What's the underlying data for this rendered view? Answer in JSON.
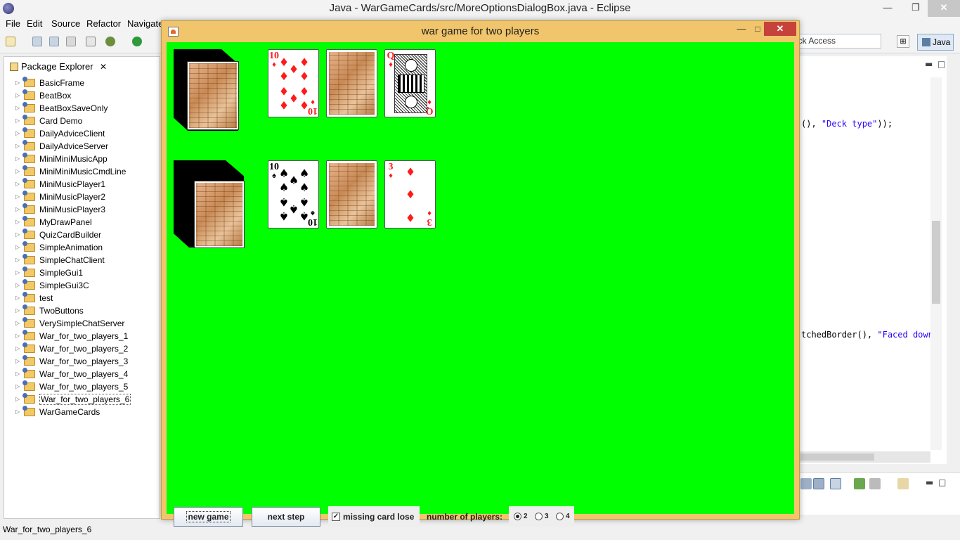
{
  "eclipse": {
    "title": "Java - WarGameCards/src/MoreOptionsDialogBox.java - Eclipse",
    "menu": [
      "File",
      "Edit",
      "Source",
      "Refactor",
      "Navigate"
    ],
    "quick_access": "ick Access",
    "perspective": "Java",
    "package_explorer": {
      "title": "Package Explorer",
      "items": [
        "BasicFrame",
        "BeatBox",
        "BeatBoxSaveOnly",
        "Card Demo",
        "DailyAdviceClient",
        "DailyAdviceServer",
        "MiniMiniMusicApp",
        "MiniMiniMusicCmdLine",
        "MiniMusicPlayer1",
        "MiniMusicPlayer2",
        "MiniMusicPlayer3",
        "MyDrawPanel",
        "QuizCardBuilder",
        "SimpleAnimation",
        "SimpleChatClient",
        "SimpleGui1",
        "SimpleGui3C",
        "test",
        "TwoButtons",
        "VerySimpleChatServer",
        "War_for_two_players_1",
        "War_for_two_players_2",
        "War_for_two_players_3",
        "War_for_two_players_4",
        "War_for_two_players_5",
        "War_for_two_players_6",
        "WarGameCards"
      ],
      "selected": "War_for_two_players_6"
    },
    "editor": {
      "line1_code": "(), ",
      "line1_string": "\"Deck type\"",
      "line1_end": "));",
      "line2_code": "tchedBorder(), ",
      "line2_string": "\"Faced down"
    },
    "status": "War_for_two_players_6"
  },
  "dialog": {
    "title": "war game for two players",
    "colors": {
      "table": "#00ff00",
      "frame": "#f0c56b",
      "close": "#c7423a"
    },
    "player1": {
      "cards": [
        {
          "rank": "10",
          "suit": "diamonds",
          "suit_symbol": "♦",
          "color": "red"
        },
        {
          "face_down": true
        },
        {
          "rank": "Q",
          "suit": "diamonds",
          "suit_symbol": "♦",
          "color": "red"
        }
      ]
    },
    "player2": {
      "cards": [
        {
          "rank": "10",
          "suit": "spades",
          "suit_symbol": "♠",
          "color": "black"
        },
        {
          "face_down": true
        },
        {
          "rank": "3",
          "suit": "diamonds",
          "suit_symbol": "♦",
          "color": "red"
        }
      ]
    },
    "controls": {
      "new_game": "new game",
      "next_step": "next step",
      "missing_card_lose": "missing card lose",
      "missing_card_lose_checked": true,
      "number_of_players_label": "number of players:",
      "player_options": [
        "2",
        "3",
        "4"
      ],
      "selected_players": "2"
    }
  }
}
